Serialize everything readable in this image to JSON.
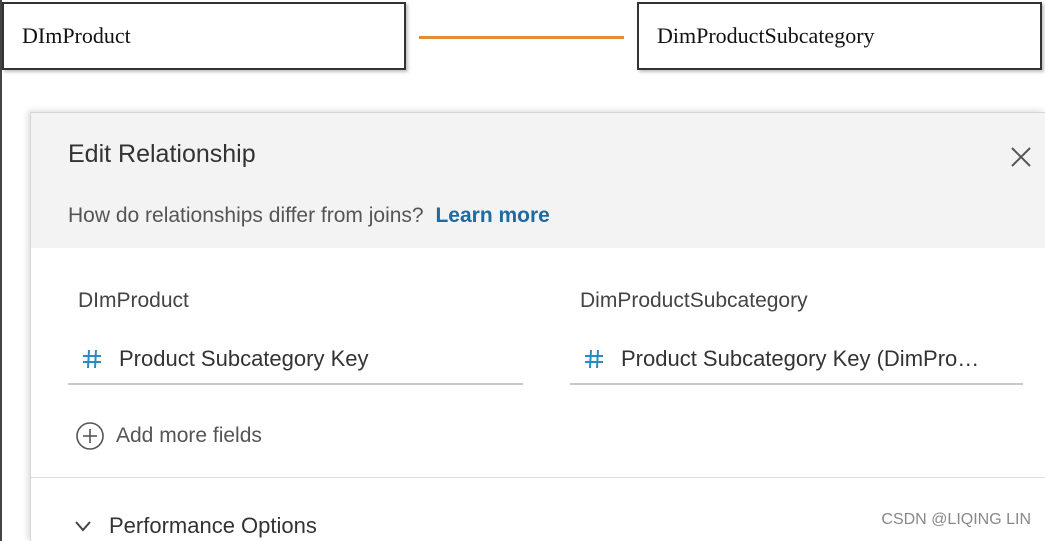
{
  "canvas": {
    "left_table": "DImProduct",
    "right_table": "DimProductSubcategory",
    "connector_color": "#e58a3c"
  },
  "dialog": {
    "title": "Edit Relationship",
    "help_text": "How do relationships differ from joins?",
    "help_link": "Learn more",
    "left_table_label": "DImProduct",
    "right_table_label": "DimProductSubcategory",
    "left_field": "Product Subcategory Key",
    "right_field": "Product Subcategory Key (DimPro…",
    "add_more_label": "Add more fields",
    "performance_label": "Performance Options",
    "accent_color": "#1f6aa0",
    "field_icon": "hash-icon"
  },
  "watermark": "CSDN @LIQING LIN"
}
